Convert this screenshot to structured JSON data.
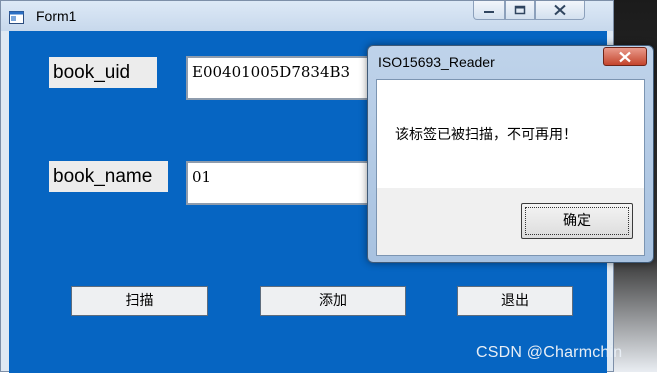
{
  "form1": {
    "title": "Form1",
    "app_icon": "form-window-icon",
    "controls": {
      "minimize_icon": "minimize-icon",
      "maximize_icon": "maximize-icon",
      "close_icon": "close-icon"
    }
  },
  "fields": {
    "book_uid": {
      "label": "book_uid",
      "value": "E00401005D7834B3"
    },
    "book_name": {
      "label": "book_name",
      "value": "01"
    }
  },
  "buttons": {
    "scan": "扫描",
    "add": "添加",
    "exit": "退出"
  },
  "dialog": {
    "title": "ISO15693_Reader",
    "message": "该标签已被扫描，不可再用！",
    "ok_label": "确定",
    "close_icon": "close-icon"
  },
  "watermark": "CSDN @Charmchin",
  "colors": {
    "form_client": "#0665c2",
    "dialog_frame": "#a8c2e0",
    "dialog_close": "#c4452d"
  }
}
